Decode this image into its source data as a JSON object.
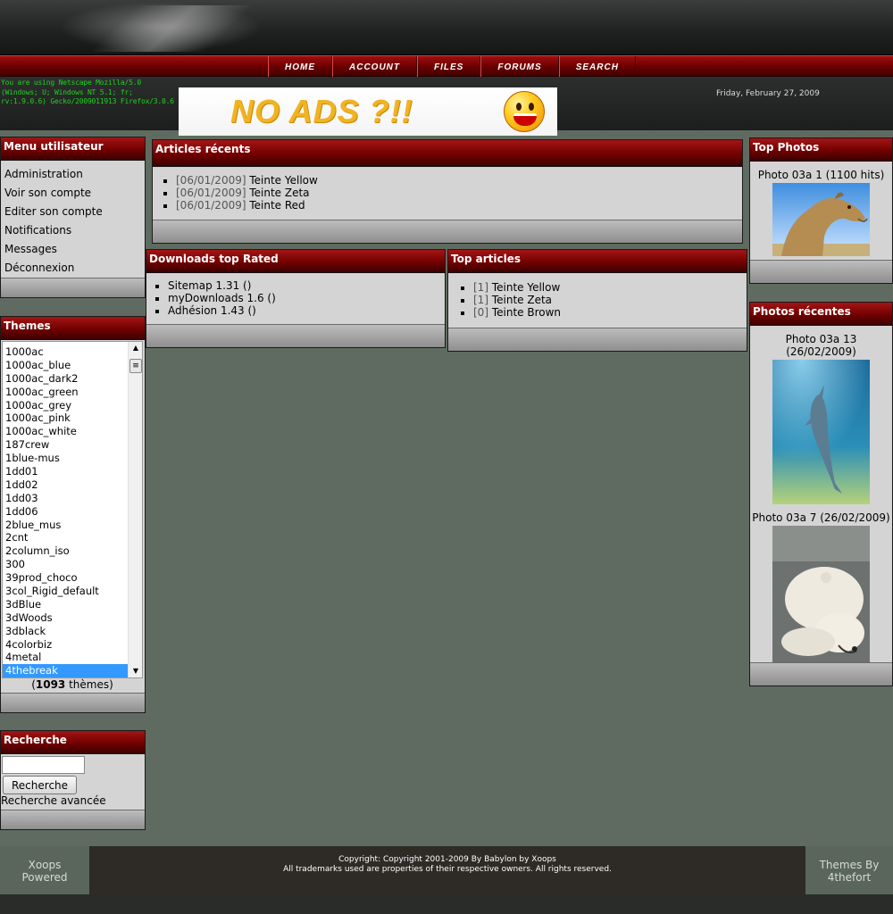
{
  "nav": {
    "items": [
      "HOME",
      "ACCOUNT",
      "FILES",
      "FORUMS",
      "SEARCH"
    ]
  },
  "header": {
    "browser_info": "You are using Netscape Mozilla/5.0 (Windows; U; Windows NT 5.1; fr; rv:1.9.0.6) Gecko/2009011913 Firefox/3.0.6",
    "ad_text": "NO ADS ?!!",
    "date": "Friday, February 27, 2009"
  },
  "user_menu": {
    "title": "Menu utilisateur",
    "items": [
      "Administration",
      "Voir son compte",
      "Editer son compte",
      "Notifications",
      "Messages",
      "Déconnexion"
    ]
  },
  "themes": {
    "title": "Themes",
    "items": [
      "1000ac",
      "1000ac_blue",
      "1000ac_dark2",
      "1000ac_green",
      "1000ac_grey",
      "1000ac_pink",
      "1000ac_white",
      "187crew",
      "1blue-mus",
      "1dd01",
      "1dd02",
      "1dd03",
      "1dd06",
      "2blue_mus",
      "2cnt",
      "2column_iso",
      "300",
      "39prod_choco",
      "3col_Rigid_default",
      "3dBlue",
      "3dWoods",
      "3dblack",
      "4colorbiz",
      "4metal",
      "4thebreak"
    ],
    "selected": "4thebreak",
    "count_prefix": "(",
    "count": "1093",
    "count_suffix": " thèmes)"
  },
  "search": {
    "title": "Recherche",
    "input_value": "",
    "button_label": "Recherche",
    "advanced_label": "Recherche avancée"
  },
  "recent_articles": {
    "title": "Articles récents",
    "items": [
      {
        "date": "[06/01/2009]",
        "title": "Teinte Yellow"
      },
      {
        "date": "[06/01/2009]",
        "title": "Teinte Zeta"
      },
      {
        "date": "[06/01/2009]",
        "title": "Teinte Red"
      }
    ]
  },
  "downloads": {
    "title": "Downloads top Rated",
    "items": [
      "Sitemap 1.31 ()",
      "myDownloads 1.6 ()",
      "Adhésion 1.43 ()"
    ]
  },
  "top_articles": {
    "title": "Top articles",
    "items": [
      {
        "count": "[1]",
        "title": "Teinte Yellow"
      },
      {
        "count": "[1]",
        "title": "Teinte Zeta"
      },
      {
        "count": "[0]",
        "title": "Teinte Brown"
      }
    ]
  },
  "top_photos": {
    "title": "Top Photos",
    "items": [
      {
        "caption": "Photo 03a 1 (1100 hits)",
        "icon": "camel-photo"
      }
    ]
  },
  "recent_photos": {
    "title": "Photos récentes",
    "items": [
      {
        "caption": "Photo 03a 13 (26/02/2009)",
        "icon": "dolphin-photo"
      },
      {
        "caption": "Photo 03a 7 (26/02/2009)",
        "icon": "polar-bear-photo"
      }
    ]
  },
  "footer": {
    "left_line1": "Xoops",
    "left_line2": "Powered",
    "copyright": "Copyright: Copyright 2001-2009 By Babylon by Xoops",
    "trademarks": "All trademarks used are properties of their respective owners. All rights reserved.",
    "right_line1": "Themes By",
    "right_line2": "4thefort"
  }
}
